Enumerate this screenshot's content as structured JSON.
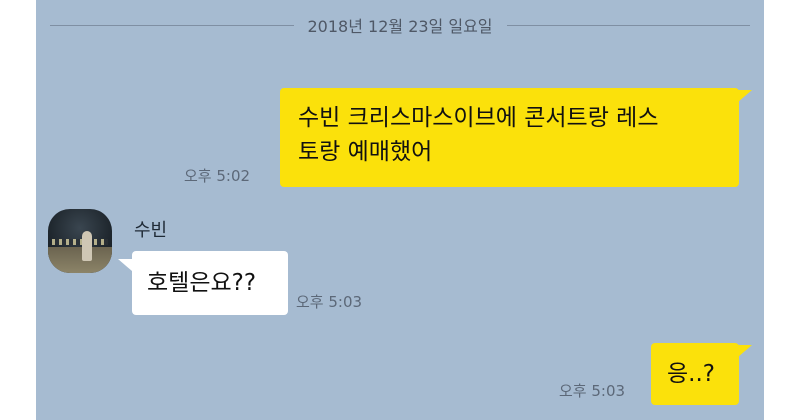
{
  "divider": {
    "date": "2018년 12월 23일 일요일"
  },
  "messages": [
    {
      "side": "mine",
      "text": "수빈 크리스마스이브에 콘서트랑 레스\n토랑 예매했어",
      "line1": "수빈 크리스마스이브에 콘서트랑 레스",
      "line2": "토랑 예매했어",
      "time": "오후 5:02"
    },
    {
      "side": "theirs",
      "sender": "수빈",
      "text": "호텔은요??",
      "time": "오후 5:03"
    },
    {
      "side": "mine",
      "text": "응..?",
      "time": "오후 5:03"
    }
  ],
  "colors": {
    "background": "#a6bbd1",
    "my_bubble": "#fbe10b",
    "their_bubble": "#ffffff"
  }
}
